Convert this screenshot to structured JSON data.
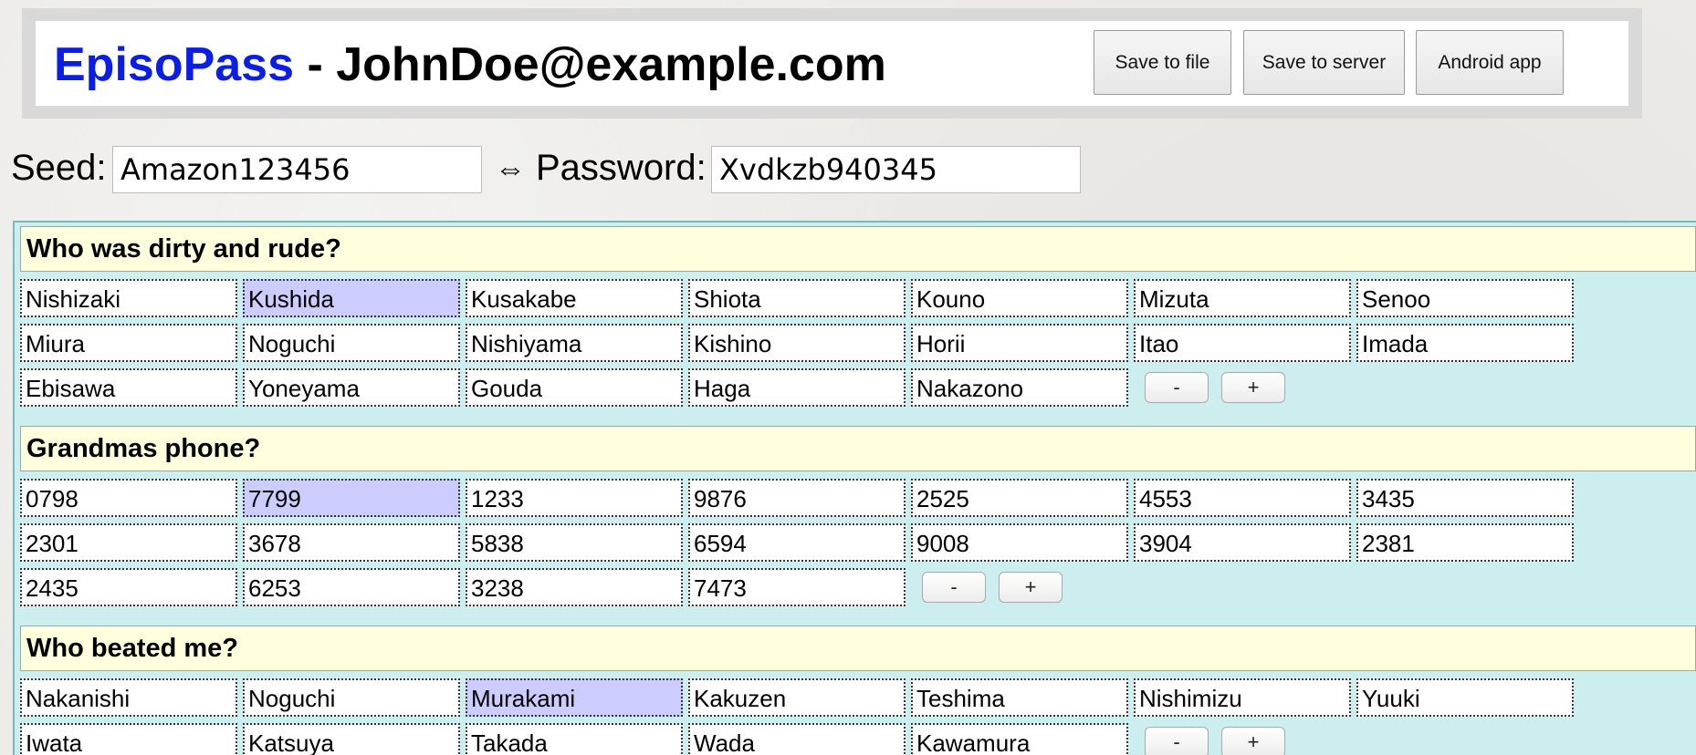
{
  "header": {
    "app_name": "EpisoPass",
    "separator": " - ",
    "user": "JohnDoe@example.com",
    "buttons": {
      "save_file": "Save to file",
      "save_server": "Save to server",
      "android": "Android app"
    }
  },
  "seed_row": {
    "seed_label": "Seed:",
    "seed_value": "Amazon123456",
    "arrow": "⇔",
    "password_label": "Password:",
    "password_value": "Xvdkzb940345"
  },
  "questions": [
    {
      "question": "Who was dirty and rude?",
      "answers": [
        "Nishizaki",
        "Kushida",
        "Kusakabe",
        "Shiota",
        "Kouno",
        "Mizuta",
        "Senoo",
        "Miura",
        "Noguchi",
        "Nishiyama",
        "Kishino",
        "Horii",
        "Itao",
        "Imada",
        "Ebisawa",
        "Yoneyama",
        "Gouda",
        "Haga",
        "Nakazono"
      ],
      "selected": "Kushida",
      "minus": "-",
      "plus": "+"
    },
    {
      "question": "Grandmas phone?",
      "answers": [
        "0798",
        "7799",
        "1233",
        "9876",
        "2525",
        "4553",
        "3435",
        "2301",
        "3678",
        "5838",
        "6594",
        "9008",
        "3904",
        "2381",
        "2435",
        "6253",
        "3238",
        "7473"
      ],
      "selected": "7799",
      "minus": "-",
      "plus": "+"
    },
    {
      "question": "Who beated me?",
      "answers": [
        "Nakanishi",
        "Noguchi",
        "Murakami",
        "Kakuzen",
        "Teshima",
        "Nishimizu",
        "Yuuki",
        "Iwata",
        "Katsuya",
        "Takada",
        "Wada",
        "Kawamura"
      ],
      "selected": "Murakami",
      "minus": "-",
      "plus": "+"
    }
  ],
  "colors": {
    "app_name": "#0b1ee6",
    "panel": "#cceeee",
    "question_bg": "#ffffdd",
    "selected_answer": "#ccccff"
  }
}
